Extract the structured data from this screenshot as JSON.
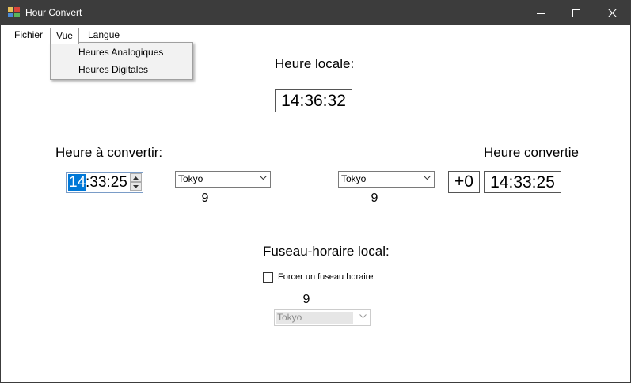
{
  "window": {
    "title": "Hour Convert"
  },
  "menu": {
    "items": [
      "Fichier",
      "Vue",
      "Langue"
    ],
    "open_menu": "Vue",
    "dropdown_items": [
      "Heures Analogiques",
      "Heures Digitales"
    ]
  },
  "local_time": {
    "label": "Heure locale:",
    "value": "14:36:32"
  },
  "convert": {
    "input_label": "Heure à convertir:",
    "input_hours_selected": "14",
    "input_rest": ":33:25",
    "source_timezone": "Tokyo",
    "source_offset": "9",
    "target_timezone": "Tokyo",
    "target_offset": "9",
    "offset_diff": "+0",
    "output_label": "Heure convertie",
    "output_value": "14:33:25"
  },
  "local_timezone": {
    "label": "Fuseau-horaire local:",
    "force_label": "Forcer un fuseau horaire",
    "force_checked": false,
    "offset": "9",
    "timezone": "Tokyo"
  },
  "colors": {
    "titlebar": "#3c3c3c",
    "selection": "#0078d7"
  }
}
